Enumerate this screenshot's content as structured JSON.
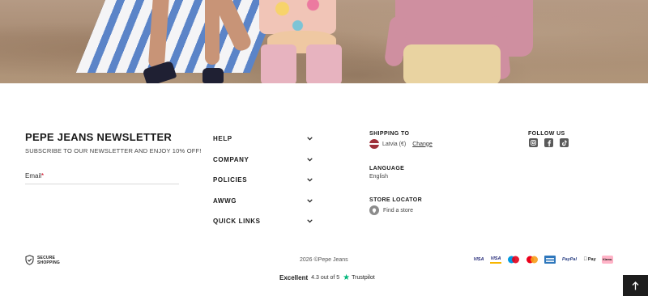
{
  "hero": {
    "image_alt": "Children standing on sand beside a striped beach towel"
  },
  "newsletter": {
    "title": "PEPE JEANS NEWSLETTER",
    "subtitle": "SUBSCRIBE TO OUR NEWSLETTER AND ENJOY 10% OFF!",
    "email_label": "Email",
    "required_mark": "*"
  },
  "accordion": [
    {
      "label": "HELP"
    },
    {
      "label": "COMPANY"
    },
    {
      "label": "POLICIES"
    },
    {
      "label": "AWWG"
    },
    {
      "label": "QUICK LINKS"
    }
  ],
  "shipping": {
    "title": "SHIPPING TO",
    "country": "Latvia (€)",
    "change": "Change"
  },
  "language": {
    "title": "LANGUAGE",
    "value": "English"
  },
  "store_locator": {
    "title": "STORE LOCATOR",
    "link": "Find a store"
  },
  "follow": {
    "title": "FOLLOW US",
    "icons": [
      "instagram-icon",
      "facebook-icon",
      "tiktok-icon"
    ]
  },
  "secure": {
    "line1": "SECURE",
    "line2": "SHOPPING"
  },
  "copyright": "2026 ©Pepe Jeans",
  "payments": {
    "visa": "VISA",
    "visa_electron": "VISA",
    "paypal": "PayPal",
    "applepay": "Pay",
    "klarna": "Klarna."
  },
  "trustpilot": {
    "label": "Excellent",
    "rating": "4.3 out of 5",
    "brand": "Trustpilot"
  },
  "colors": {
    "text": "#1a1a1a",
    "required": "#d0021b",
    "trustpilot_green": "#00b67a",
    "back_to_top_bg": "#1d1d1d"
  }
}
